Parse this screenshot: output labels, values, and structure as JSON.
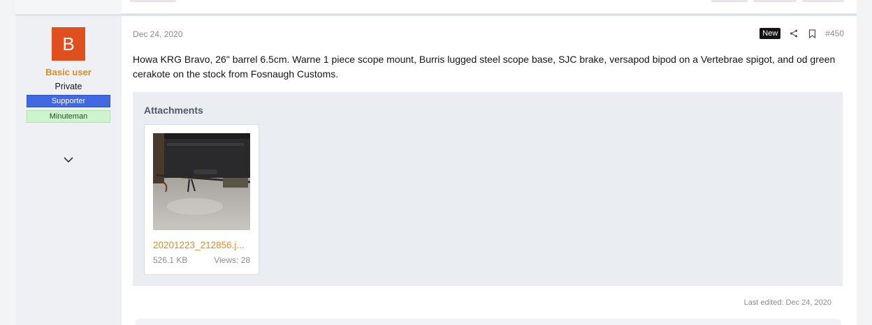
{
  "post": {
    "date": "Dec 24, 2020",
    "badge": "New",
    "number": "#450",
    "body": "Howa KRG Bravo, 26\" barrel 6.5cm. Warne 1 piece scope mount, Burris lugged steel scope base, SJC brake, versapod bipod on a Vertebrae spigot, and od green cerakote on the stock from Fosnaugh Customs.",
    "last_edited": "Last edited: Dec 24, 2020"
  },
  "user": {
    "avatar_letter": "B",
    "name": "Basic user",
    "title": "Private",
    "banners": [
      "Supporter",
      "Minuteman"
    ]
  },
  "attachments": {
    "heading": "Attachments",
    "items": [
      {
        "filename": "20201223_212856.j...",
        "size": "526.1 KB",
        "views": "Views: 28"
      }
    ]
  },
  "colors": {
    "accent": "#de8c1e",
    "avatar_bg": "#e0501f",
    "supporter_bg": "#4169e1",
    "minuteman_bg": "#ccf5cc"
  },
  "icons": [
    "chevron-down-icon",
    "share-icon",
    "bookmark-icon"
  ]
}
